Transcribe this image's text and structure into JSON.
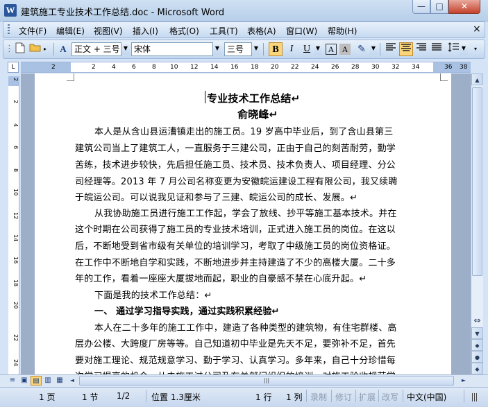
{
  "window": {
    "title": "建筑施工专业技术工作总结.doc - Microsoft Word",
    "app_icon": "W",
    "controls": {
      "minimize": "—",
      "maximize": "□",
      "close": "✕"
    }
  },
  "menubar": {
    "items": [
      "文件(F)",
      "编辑(E)",
      "视图(V)",
      "插入(I)",
      "格式(O)",
      "工具(T)",
      "表格(A)",
      "窗口(W)",
      "帮助(H)"
    ],
    "close": "×"
  },
  "toolbar": {
    "style_value": "正文 + 三号",
    "font_value": "宋体",
    "size_value": "三号",
    "bold": "B",
    "italic": "I",
    "underline": "U",
    "char_border": "A",
    "char_shading": "A",
    "icons": [
      "new-document-icon",
      "open-folder-icon",
      "styles-formatting-icon",
      "highlight-icon",
      "align-left-icon",
      "align-center-icon",
      "align-right-icon",
      "justify-icon",
      "line-spacing-icon"
    ]
  },
  "ruler": {
    "numbers": [
      "2",
      "2",
      "4",
      "6",
      "8",
      "10",
      "12",
      "14",
      "16",
      "18",
      "20",
      "22",
      "24",
      "26",
      "28",
      "30",
      "32",
      "34",
      "36",
      "38"
    ]
  },
  "vruler": {
    "numbers": [
      "2",
      "2",
      "4",
      "6",
      "8",
      "10",
      "12",
      "14",
      "16",
      "18",
      "20",
      "22",
      "24"
    ]
  },
  "document": {
    "lines": [
      {
        "text": "专业技术工作总结↵",
        "bold": true
      },
      {
        "text": "俞晓峰↵",
        "bold": true
      },
      {
        "text": "本人是从含山县运漕镇走出的施工员。19 岁高中毕业后，到了含山县第三"
      },
      {
        "text": "建筑公司当上了建筑工人，一直服务于三建公司，正由于自己的刻苦耐劳，勤学"
      },
      {
        "text": "苦练，技术进步较快，先后担任施工员、技术员、技术负责人、项目经理、分公"
      },
      {
        "text": "司经理等。2013 年 7 月公司名称变更为安徽皖运建设工程有限公司，我又续聘"
      },
      {
        "text": "于皖运公司。可以说我见证和参与了三建、皖运公司的成长、发展。↵"
      },
      {
        "text": "从我协助施工员进行施工工作起，学会了放线、抄平等施工基本技术。并在"
      },
      {
        "text": "这个时期在公司获得了施工员的专业技术培训，正式进入施工员的岗位。在这以"
      },
      {
        "text": "后，不断地受到省市级有关单位的培训学习，考取了中级施工员的岗位资格证。"
      },
      {
        "text": "在工作中不断地自学和实践，不断地进步并主持建造了不少的高楼大厦。二十多"
      },
      {
        "text": "年的工作，看着一座座大厦拔地而起，职业的自豪感不禁在心底升起。↵"
      },
      {
        "text": "下面是我的技术工作总结：↵"
      },
      {
        "text": "一、  通过学习指导实践，通过实践积累经验↵",
        "bold": true
      },
      {
        "text": "本人在二十多年的施工工作中，建造了各种类型的建筑物，有住宅群楼、高"
      },
      {
        "text": "层办公楼、大跨度厂房等等。自己知道初中毕业是先天不足，要弥补不足，首先"
      },
      {
        "text": "要对施工理论、规范规意学习、勤于学习、认真学习。多年来，自己十分珍惜每"
      },
      {
        "text": "次学习提高的机会，从去施工过公司及有关部门组织的培训，对施工验收规范学"
      }
    ]
  },
  "scrollbar": {
    "up": "▲",
    "down": "▼",
    "prev_page": "◆",
    "browse": "●",
    "next_page": "◆"
  },
  "hscroll": {
    "left": "◄",
    "right": "►",
    "grip": "|||",
    "view_buttons": [
      "≡",
      "▣",
      "▤",
      "▥",
      "▦"
    ]
  },
  "statusbar": {
    "page": "1 页",
    "section": "1 节",
    "page_of": "1/2",
    "position": "位置 1.3厘米",
    "line": "1 行",
    "column": "1 列",
    "rec": "录制",
    "trk": "修订",
    "ext": "扩展",
    "ovr": "改写",
    "language": "中文(中国)"
  },
  "colors": {
    "accent": "#2b579a",
    "active_button": "#fbd57a",
    "doc_background": "#9daec8"
  }
}
